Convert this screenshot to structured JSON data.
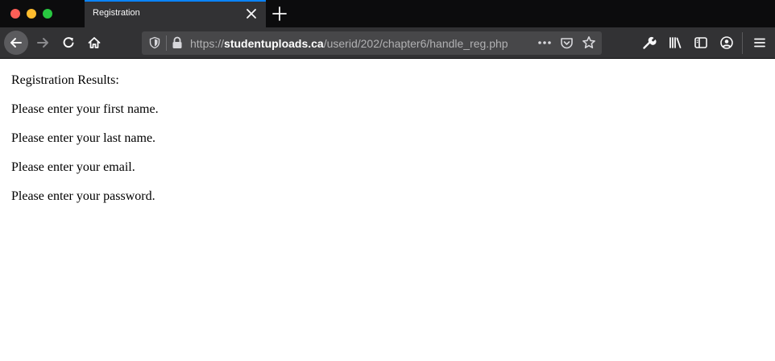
{
  "browser": {
    "tab": {
      "title": "Registration"
    },
    "url": {
      "protocol": "https://",
      "domain": "studentuploads.ca",
      "path": "/userid/202/chapter6/handle_reg.php"
    },
    "icons": [
      "back-arrow-icon",
      "forward-arrow-icon",
      "reload-icon",
      "home-icon",
      "shield-icon",
      "lock-icon",
      "more-dots-icon",
      "pocket-icon",
      "star-icon",
      "wrench-icon",
      "library-icon",
      "sidebar-icon",
      "account-icon",
      "hamburger-menu-icon"
    ],
    "colors": {
      "tab_accent": "#0a84ff",
      "chrome_dark": "#0c0c0d",
      "toolbar": "#323234",
      "urlbar": "#474749"
    }
  },
  "page": {
    "heading": "Registration Results:",
    "messages": [
      "Please enter your first name.",
      "Please enter your last name.",
      "Please enter your email.",
      "Please enter your password."
    ]
  }
}
